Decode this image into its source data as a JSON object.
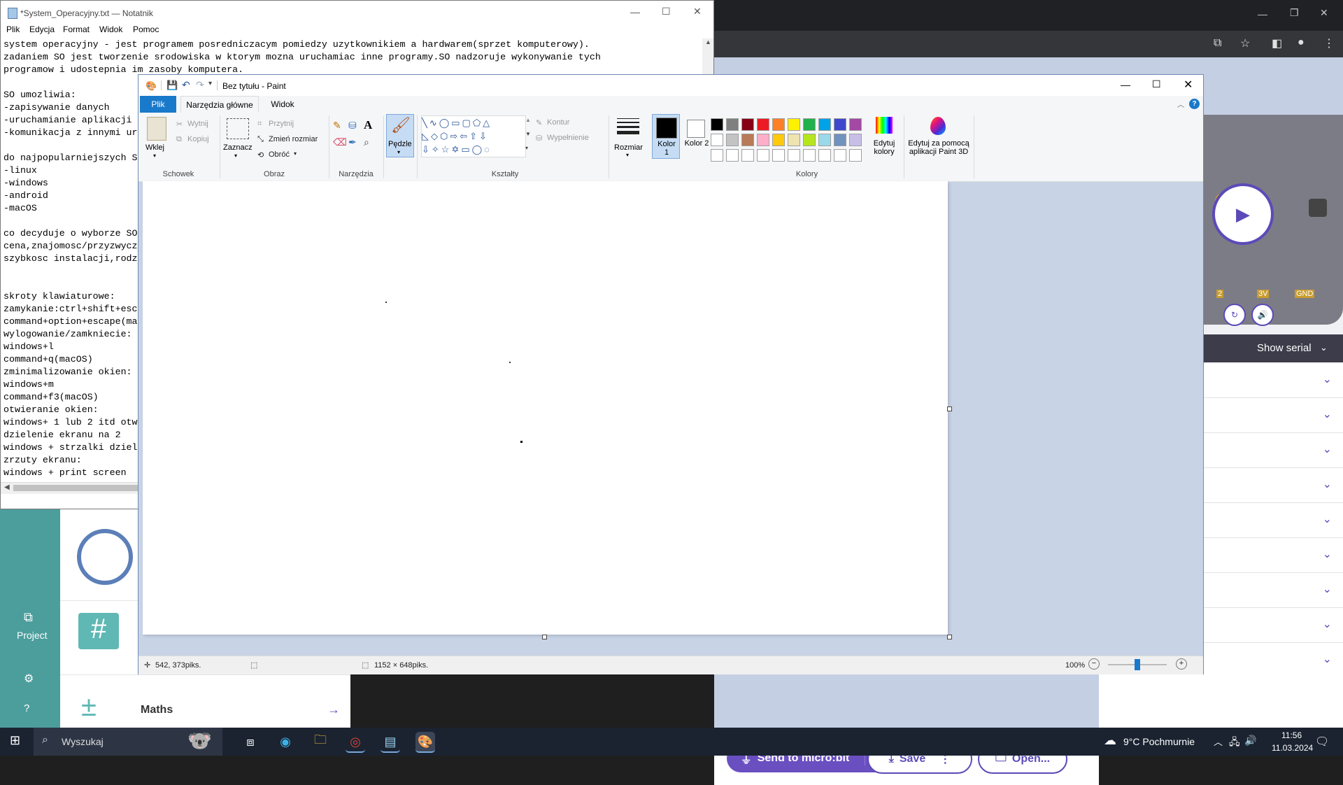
{
  "notepad": {
    "title": "*System_Operacyjny.txt — Notatnik",
    "menu": [
      "Plik",
      "Edycja",
      "Format",
      "Widok",
      "Pomoc"
    ],
    "lines": [
      "system operacyjny - jest programem posredniczacym pomiedzy uzytkownikiem a hardwarem(sprzet komputerowy).",
      "zadaniem SO jest tworzenie srodowiska w ktorym mozna uruchamiac inne programy.SO nadzoruje wykonywanie tych",
      "programow i udostepnia im zasoby komputera.",
      "",
      "SO umozliwia:",
      "-zapisywanie danych",
      "-uruchamianie aplikacji",
      "-komunikacja z innymi ur",
      "",
      "do najpopularniejszych S",
      "-linux",
      "-windows",
      "-android",
      "-macOS",
      "",
      "co decyduje o wyborze SO",
      "cena,znajomosc/przyzwycz",
      "szybkosc instalacji,rodz",
      "",
      "",
      "skroty klawiaturowe:",
      "zamykanie:ctrl+shift+esc",
      "command+option+escape(ma",
      "wylogowanie/zamkniecie:",
      "windows+l",
      "command+q(macOS)",
      "zminimalizowanie okien:",
      "windows+m",
      "command+f3(macOS)",
      "otwieranie okien:",
      "windows+ 1 lub 2 itd otw",
      "dzielenie ekranu na 2",
      "windows + strzalki dziel",
      "zrzuty ekranu:",
      "windows + print screen"
    ]
  },
  "paint": {
    "title": "Bez tytułu - Paint",
    "tabs": [
      "Plik",
      "Narzędzia główne",
      "Widok"
    ],
    "schowek": {
      "paste": "Wklej",
      "cut": "Wytnij",
      "copy": "Kopiuj",
      "label": "Schowek"
    },
    "obraz": {
      "select": "Zaznacz",
      "crop": "Przytnij",
      "resize": "Zmień rozmiar",
      "rotate": "Obróć",
      "label": "Obraz"
    },
    "narzedzia": {
      "label": "Narzędzia"
    },
    "pedzle": "Pędzle",
    "ksztalty": {
      "outline": "Kontur",
      "fill": "Wypełnienie",
      "label": "Kształty"
    },
    "rozmiar": "Rozmiar",
    "kolor1": "Kolor 1",
    "kolor2": "Kolor 2",
    "kolory": {
      "label": "Kolory",
      "edit": "Edytuj kolory",
      "paint3d": "Edytuj za pomocą aplikacji Paint 3D"
    },
    "palette_row1": [
      "#000000",
      "#7f7f7f",
      "#880015",
      "#ed1c24",
      "#ff7f27",
      "#fff200",
      "#22b14c",
      "#00a2e8",
      "#3f48cc",
      "#a349a4"
    ],
    "palette_row2": [
      "#ffffff",
      "#c3c3c3",
      "#b97a57",
      "#ffaec9",
      "#ffc90e",
      "#efe4b0",
      "#b5e61d",
      "#99d9ea",
      "#7092be",
      "#c8bfe7"
    ],
    "status": {
      "position": "542, 373piks.",
      "size": "1152 × 648piks.",
      "zoom": "100%"
    }
  },
  "makecode": {
    "show_serial": "Show serial",
    "project": "Project",
    "maths": "Maths",
    "send": "Send to micro:bit",
    "save": "Save",
    "open": "Open...",
    "pins": [
      "2",
      "3V",
      "GND"
    ]
  },
  "taskbar": {
    "search": "Wyszukaj",
    "weather": "9°C Pochmurnie",
    "time": "11:56",
    "date": "11.03.2024"
  }
}
